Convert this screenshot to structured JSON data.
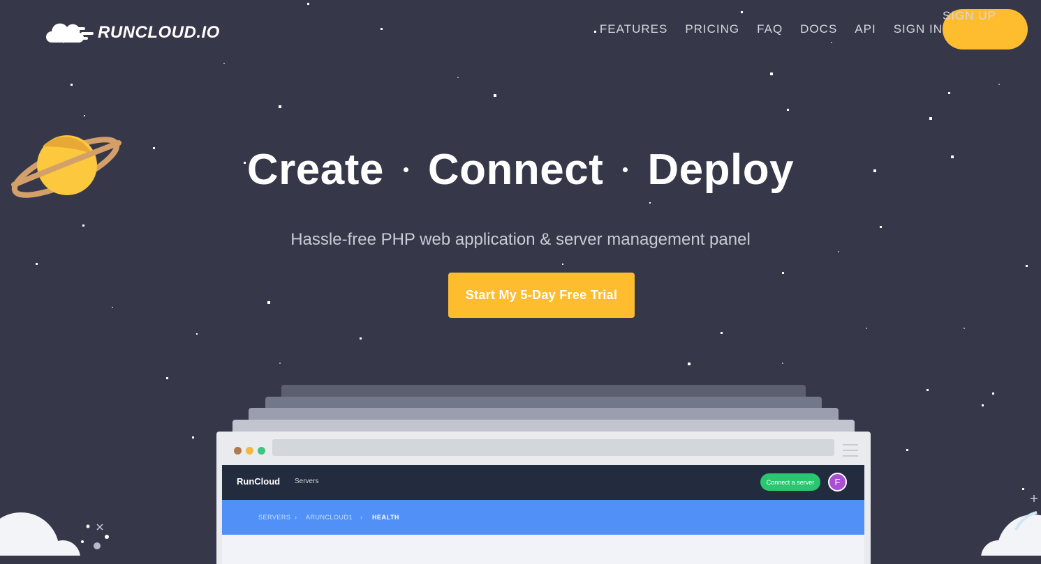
{
  "brand": {
    "name": "RUNCLOUD.IO"
  },
  "nav": {
    "items": [
      "FEATURES",
      "PRICING",
      "FAQ",
      "DOCS",
      "API",
      "SIGN IN"
    ],
    "signup": "SIGN UP"
  },
  "hero": {
    "word1": "Create",
    "word2": "Connect",
    "word3": "Deploy",
    "subtitle": "Hassle-free PHP web application & server management panel",
    "cta": "Start My 5-Day Free Trial"
  },
  "preview": {
    "brand": "RunCloud",
    "servers_link": "Servers",
    "connect_button": "Connect a server",
    "avatar_initial": "F",
    "breadcrumb": [
      "SERVERS",
      "ARUNCLOUD1",
      "HEALTH"
    ]
  },
  "colors": {
    "background": "#363849",
    "accent": "#fdbd2f",
    "preview_header": "#232c3e",
    "preview_breadcrumb": "#5090f7",
    "connect_green": "#29c76f"
  }
}
